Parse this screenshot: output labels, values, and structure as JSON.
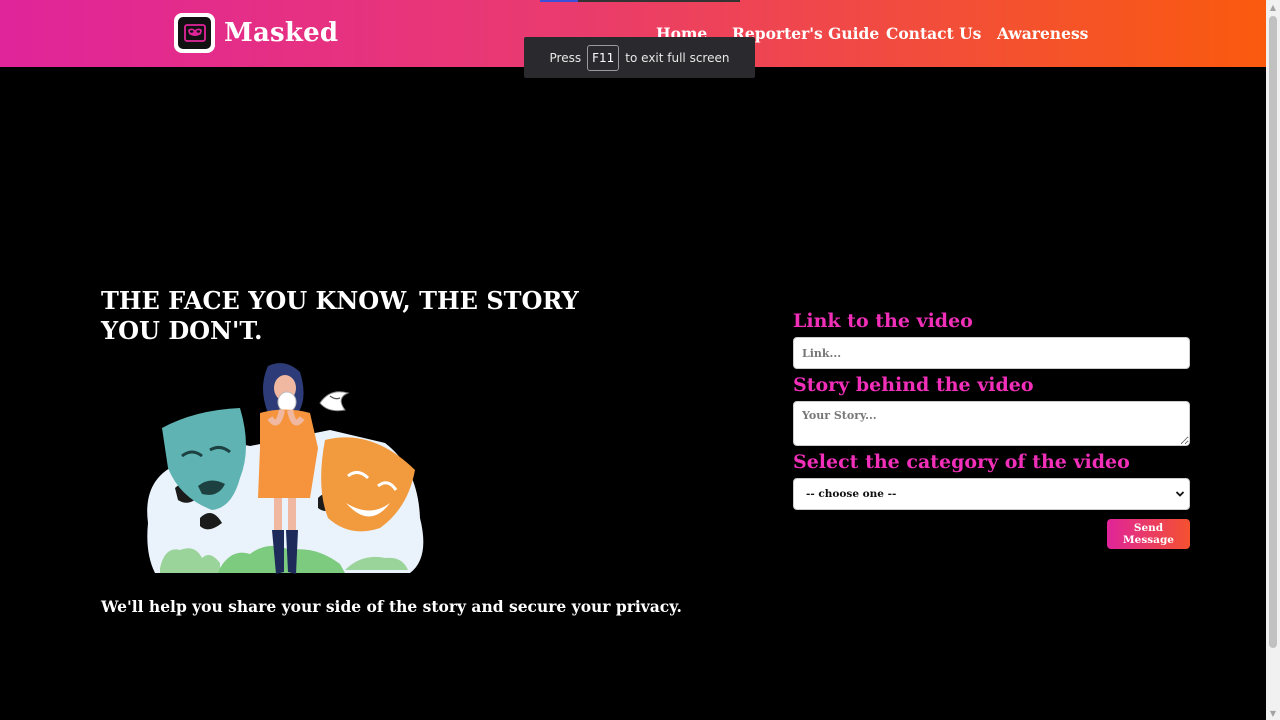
{
  "brand": {
    "name": "Masked",
    "logo_icon": "theatre-mask-icon"
  },
  "nav": {
    "items": [
      {
        "label": "Home"
      },
      {
        "label": "Reporter's Guide"
      },
      {
        "label": "Contact Us"
      },
      {
        "label": "Awareness"
      }
    ]
  },
  "fullscreen_notice": {
    "before": "Press",
    "key": "F11",
    "after": "to exit full screen"
  },
  "hero": {
    "headline": "THE FACE YOU KNOW, THE STORY YOU DON'T.",
    "subtext": "We'll help you share your side of the story and secure your privacy."
  },
  "form": {
    "link_label": "Link to the video",
    "link_placeholder": "Link...",
    "story_label": "Story behind the video",
    "story_placeholder": "Your Story...",
    "category_label": "Select the category of the video",
    "category_selected": "-- choose one --",
    "send_label": "Send Message"
  },
  "colors": {
    "gradient_start": "#e0249a",
    "gradient_end": "#fa5a0e",
    "label_pink": "#f12fb9",
    "background": "#000000"
  }
}
